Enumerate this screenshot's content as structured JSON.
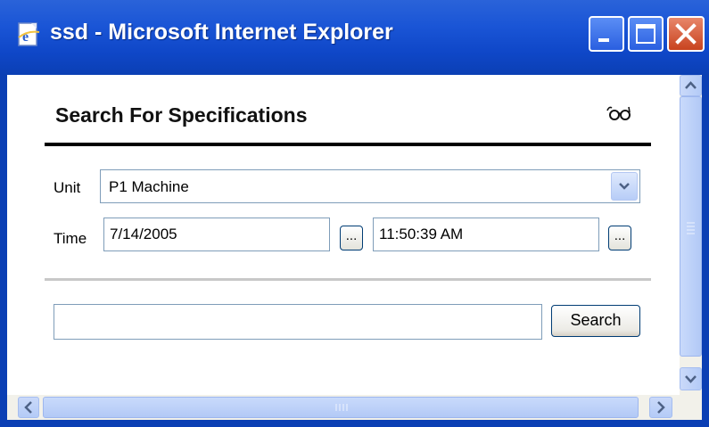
{
  "window": {
    "title": "ssd - Microsoft Internet Explorer",
    "minimize_icon": "minimize-icon",
    "maximize_icon": "maximize-icon",
    "close_icon": "close-icon",
    "titlebar_color": "#0f47c8",
    "close_color": "#c8431f"
  },
  "page": {
    "title": "Search For Specifications",
    "title_icon": "glasses-icon"
  },
  "form": {
    "unit_label": "Unit",
    "unit_value": "P1 Machine",
    "time_label": "Time",
    "date_value": "7/14/2005",
    "date_picker_label": "...",
    "time_value": "11:50:39 AM",
    "time_picker_label": "...",
    "search_value": "",
    "search_button_label": "Search"
  },
  "scrollbars": {
    "vertical": true,
    "horizontal": true
  }
}
